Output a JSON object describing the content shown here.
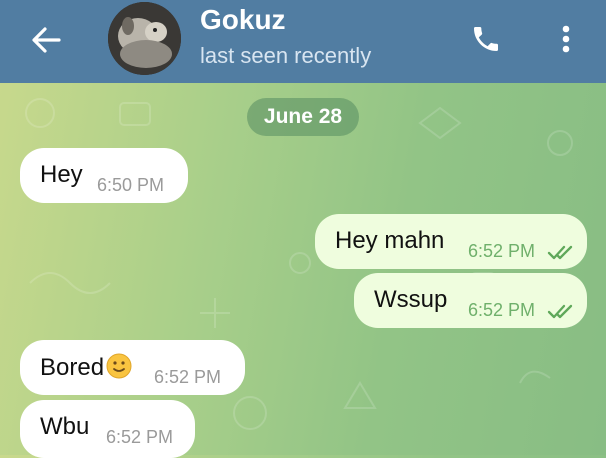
{
  "header": {
    "contact_name": "Gokuz",
    "status": "last seen recently"
  },
  "chat": {
    "date_badge": "June 28",
    "messages": [
      {
        "direction": "incoming",
        "text": "Hey",
        "time": "6:50 PM"
      },
      {
        "direction": "outgoing",
        "text": "Hey mahn",
        "time": "6:52 PM",
        "status": "read"
      },
      {
        "direction": "outgoing",
        "text": "Wssup",
        "time": "6:52 PM",
        "status": "read"
      },
      {
        "direction": "incoming",
        "text": "Bored",
        "emoji": "slightly-smiling-face",
        "time": "6:52 PM"
      },
      {
        "direction": "incoming",
        "text": "Wbu",
        "time": "6:52 PM"
      }
    ]
  },
  "colors": {
    "header_bg": "#517da2",
    "incoming_bubble": "#ffffff",
    "outgoing_bubble": "#effdde",
    "read_checks": "#5fa85a"
  },
  "icons": [
    "back-arrow-icon",
    "phone-icon",
    "more-vertical-icon",
    "double-check-icon",
    "smiley-emoji-icon"
  ]
}
